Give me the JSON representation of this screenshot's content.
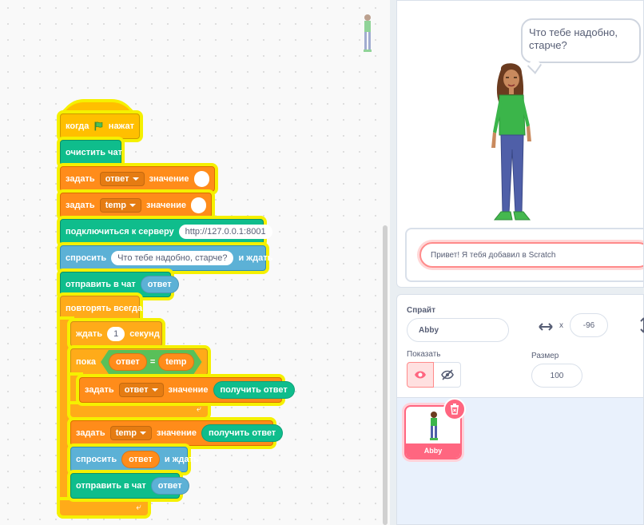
{
  "script": {
    "when_flag": {
      "pre": "когда",
      "post": "нажат"
    },
    "clear_chat": "очистить чат",
    "set1": {
      "label": "задать",
      "var": "ответ",
      "value_label": "значение"
    },
    "set2": {
      "label": "задать",
      "var": "temp",
      "value_label": "значение"
    },
    "connect": {
      "label": "подключиться к серверу",
      "url": "http://127.0.0.1:8001"
    },
    "ask1": {
      "label": "спросить",
      "question": "Что тебе надобно, старче?",
      "post": "и ждать"
    },
    "send1": {
      "label": "отправить в чат",
      "arg": "ответ"
    },
    "forever": "повторять всегда",
    "wait": {
      "label": "ждать",
      "value": "1",
      "unit": "секунд"
    },
    "while": {
      "label": "пока",
      "left": "ответ",
      "op": "=",
      "right": "temp"
    },
    "inner_set": {
      "label": "задать",
      "var": "ответ",
      "value_label": "значение",
      "reporter": "получить ответ"
    },
    "set3": {
      "label": "задать",
      "var": "temp",
      "value_label": "значение",
      "reporter": "получить ответ"
    },
    "ask2": {
      "label": "спросить",
      "arg": "ответ",
      "post": "и ждать"
    },
    "send2": {
      "label": "отправить в чат",
      "arg": "ответ"
    }
  },
  "stage": {
    "speech": "Что тебе надобно, старче?",
    "ask_input_value": "Привет! Я тебя добавил в Scratch"
  },
  "sprite_info": {
    "sprite_label": "Спрайт",
    "sprite_name": "Abby",
    "x_label": "x",
    "x_value": "-96",
    "show_label": "Показать",
    "size_label": "Размер",
    "size_value": "100"
  },
  "sprite_list": {
    "items": [
      {
        "name": "Abby",
        "selected": true
      }
    ]
  },
  "colors": {
    "events": "#ffbf00",
    "extension": "#0fbd8c",
    "data": "#ff8c1a",
    "sensing": "#5cb1d6",
    "control": "#ffab19",
    "operators": "#59c059",
    "glow": "#f5f000",
    "selected": "#ff6680"
  }
}
